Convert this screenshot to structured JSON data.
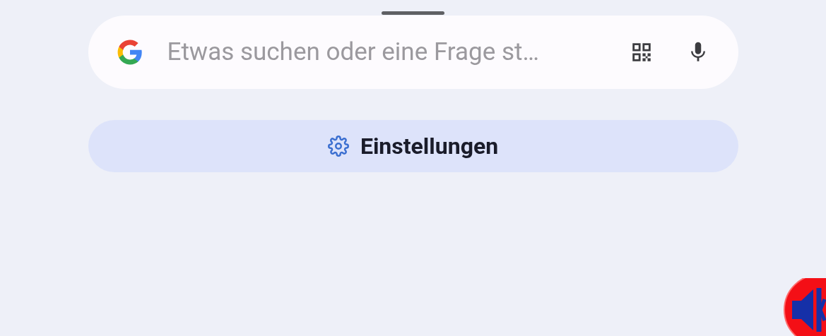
{
  "search": {
    "placeholder": "Etwas suchen oder eine Frage st…"
  },
  "settings_button": {
    "label": "Einstellungen"
  }
}
